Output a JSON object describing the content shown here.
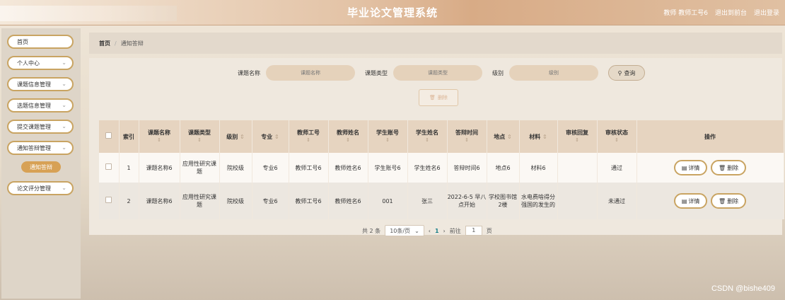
{
  "header": {
    "title": "毕业论文管理系统",
    "user_label": "教师 教师工号6",
    "back_front": "退出到前台",
    "logout": "退出登录"
  },
  "sidebar": {
    "items": [
      {
        "label": "首页",
        "has_chevron": false
      },
      {
        "label": "个人中心",
        "has_chevron": true
      },
      {
        "label": "课题信息管理",
        "has_chevron": true
      },
      {
        "label": "选题信息管理",
        "has_chevron": true
      },
      {
        "label": "提交课题管理",
        "has_chevron": true
      },
      {
        "label": "通知答辩管理",
        "has_chevron": true
      }
    ],
    "active_sub": "通知答辩",
    "last_item": "论文评分管理"
  },
  "breadcrumb": {
    "home": "首页",
    "current": "通知答辩"
  },
  "search": {
    "name_label": "课题名称",
    "name_placeholder": "课题名称",
    "type_label": "课题类型",
    "type_placeholder": "课题类型",
    "level_label": "级别",
    "level_placeholder": "级别",
    "search_button": "查询"
  },
  "batch_delete": "删除",
  "table": {
    "headers": [
      "索引",
      "课题名称",
      "课题类型",
      "级别",
      "专业",
      "教师工号",
      "教师姓名",
      "学生账号",
      "学生姓名",
      "答辩时间",
      "地点",
      "材料",
      "审核回复",
      "审核状态",
      "操作"
    ],
    "rows": [
      [
        "1",
        "课题名称6",
        "应用性研究课题",
        "院校级",
        "专业6",
        "教师工号6",
        "教师姓名6",
        "学生账号6",
        "学生姓名6",
        "答辩时间6",
        "地点6",
        "材料6",
        "",
        "通过"
      ],
      [
        "2",
        "课题名称6",
        "应用性研究课题",
        "院校级",
        "专业6",
        "教师工号6",
        "教师姓名6",
        "001",
        "张三",
        "2022-6-5 早八点开始",
        "学校图书馆2楼",
        "水电费啥得分强国的发生的",
        "",
        "未通过"
      ]
    ],
    "detail_label": "详情",
    "delete_label": "删除"
  },
  "pagination": {
    "total": "共 2 条",
    "page_size": "10条/页",
    "current": "1",
    "goto_label": "前往",
    "goto_value": "1",
    "page_unit": "页"
  },
  "watermark": "CSDN @bishe409"
}
